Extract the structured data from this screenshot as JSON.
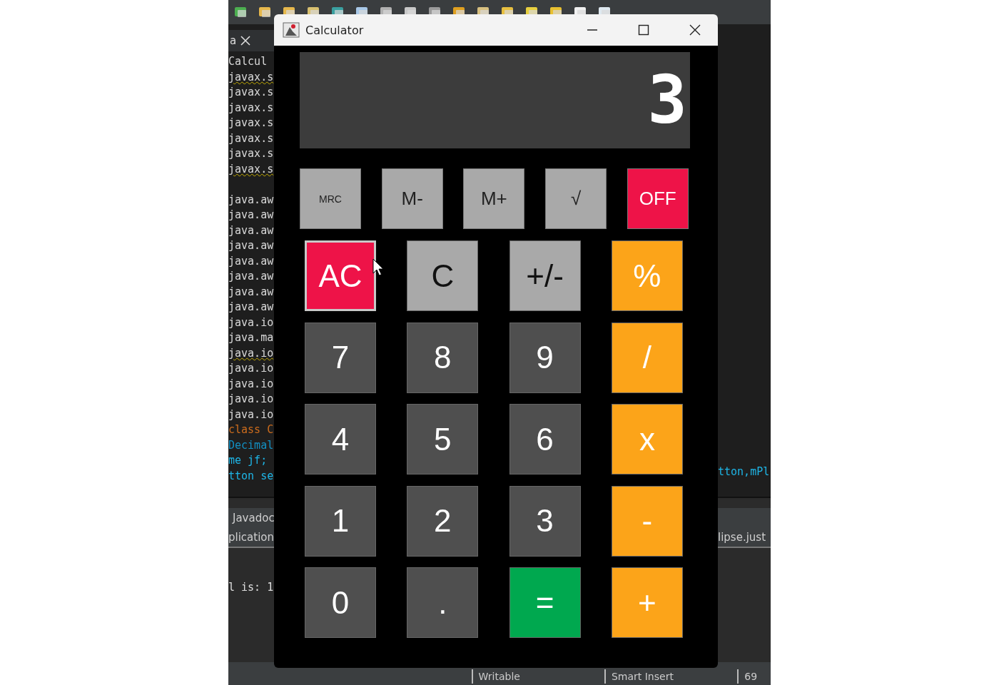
{
  "ide": {
    "editor_tab": {
      "label": "a"
    },
    "code_lines": [
      {
        "kind": "code",
        "text": "Calcul",
        "color": "#d8d8d8",
        "squiggle": false
      },
      {
        "kind": "code",
        "text": "javax.s",
        "color": "#d8d8d8",
        "squiggle": true
      },
      {
        "kind": "code",
        "text": "javax.s",
        "color": "#d8d8d8",
        "squiggle": false
      },
      {
        "kind": "code",
        "text": "javax.s",
        "color": "#d8d8d8",
        "squiggle": false
      },
      {
        "kind": "code",
        "text": "javax.s",
        "color": "#d8d8d8",
        "squiggle": false
      },
      {
        "kind": "code",
        "text": "javax.s",
        "color": "#d8d8d8",
        "squiggle": false
      },
      {
        "kind": "code",
        "text": "javax.s",
        "color": "#d8d8d8",
        "squiggle": false
      },
      {
        "kind": "code",
        "text": "javax.s",
        "color": "#d8d8d8",
        "squiggle": true
      },
      {
        "kind": "blank"
      },
      {
        "kind": "code",
        "text": "java.aw",
        "color": "#d8d8d8",
        "squiggle": false
      },
      {
        "kind": "code",
        "text": "java.aw",
        "color": "#d8d8d8",
        "squiggle": false
      },
      {
        "kind": "code",
        "text": "java.aw",
        "color": "#d8d8d8",
        "squiggle": false
      },
      {
        "kind": "code",
        "text": "java.aw",
        "color": "#d8d8d8",
        "squiggle": false
      },
      {
        "kind": "code",
        "text": "java.aw",
        "color": "#d8d8d8",
        "squiggle": false
      },
      {
        "kind": "code",
        "text": "java.aw",
        "color": "#d8d8d8",
        "squiggle": false
      },
      {
        "kind": "code",
        "text": "java.aw",
        "color": "#d8d8d8",
        "squiggle": false
      },
      {
        "kind": "code",
        "text": "java.aw",
        "color": "#d8d8d8",
        "squiggle": false
      },
      {
        "kind": "code",
        "text": "java.io",
        "color": "#d8d8d8",
        "squiggle": false
      },
      {
        "kind": "code",
        "text": "java.ma",
        "color": "#d8d8d8",
        "squiggle": false
      },
      {
        "kind": "code",
        "text": "java.io",
        "color": "#d8d8d8",
        "squiggle": true
      },
      {
        "kind": "code",
        "text": "java.io",
        "color": "#d8d8d8",
        "squiggle": false
      },
      {
        "kind": "code",
        "text": "java.io",
        "color": "#d8d8d8",
        "squiggle": false
      },
      {
        "kind": "code",
        "text": "java.io",
        "color": "#d8d8d8",
        "squiggle": false
      },
      {
        "kind": "code",
        "text": "java.io",
        "color": "#d8d8d8",
        "squiggle": false
      },
      {
        "kind": "code",
        "text": "class C",
        "color": "#cc6c1d",
        "squiggle": false
      },
      {
        "kind": "code",
        "text": "Decimal",
        "color": "#1290c3",
        "squiggle": false
      },
      {
        "kind": "code",
        "text": "me jf;",
        "color": "#1eb5e6",
        "squiggle": false
      },
      {
        "kind": "code",
        "text": "tton se",
        "color": "#1eb5e6",
        "squiggle": false
      }
    ],
    "right_code": {
      "text": "tton,mPl",
      "color": "#1eb5e6"
    },
    "bottom_panel": {
      "tab": "Javadoc",
      "left_header": "plication",
      "right_header": "lipse.just",
      "output": "l is: 1"
    },
    "status_bar": [
      "Writable",
      "Smart Insert",
      "69"
    ]
  },
  "calculator": {
    "title": "Calculator",
    "display": "3",
    "memory_buttons": [
      {
        "label": "MRC",
        "kind": "recall"
      },
      {
        "label": "M-",
        "kind": "memory"
      },
      {
        "label": "M+",
        "kind": "memory"
      },
      {
        "label": "√",
        "kind": "memory"
      },
      {
        "label": "OFF",
        "kind": "power"
      }
    ],
    "buttons": [
      {
        "label": "AC",
        "kind": "clear",
        "focused": true
      },
      {
        "label": "C",
        "kind": "function",
        "focused": false
      },
      {
        "label": "+/-",
        "kind": "function",
        "focused": false
      },
      {
        "label": "%",
        "kind": "operator",
        "focused": false
      },
      {
        "label": "7",
        "kind": "digit",
        "focused": false
      },
      {
        "label": "8",
        "kind": "digit",
        "focused": false
      },
      {
        "label": "9",
        "kind": "digit",
        "focused": false
      },
      {
        "label": "/",
        "kind": "operator",
        "focused": false
      },
      {
        "label": "4",
        "kind": "digit",
        "focused": false
      },
      {
        "label": "5",
        "kind": "digit",
        "focused": false
      },
      {
        "label": "6",
        "kind": "digit",
        "focused": false
      },
      {
        "label": "x",
        "kind": "operator",
        "focused": false
      },
      {
        "label": "1",
        "kind": "digit",
        "focused": false
      },
      {
        "label": "2",
        "kind": "digit",
        "focused": false
      },
      {
        "label": "3",
        "kind": "digit",
        "focused": false
      },
      {
        "label": "-",
        "kind": "operator",
        "focused": false
      },
      {
        "label": "0",
        "kind": "digit",
        "focused": false
      },
      {
        "label": ".",
        "kind": "digit",
        "focused": false
      },
      {
        "label": "=",
        "kind": "equals",
        "focused": false
      },
      {
        "label": "+",
        "kind": "operator",
        "focused": false
      }
    ]
  }
}
